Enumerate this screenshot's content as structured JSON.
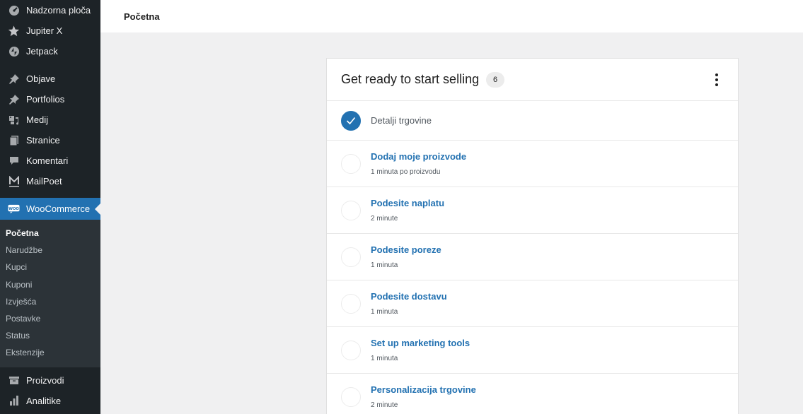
{
  "sidebar": {
    "items": [
      {
        "label": "Nadzorna ploča",
        "icon": "dashboard-icon"
      },
      {
        "label": "Jupiter X",
        "icon": "star-icon"
      },
      {
        "label": "Jetpack",
        "icon": "jetpack-icon"
      },
      {
        "label": "Objave",
        "icon": "pin-icon"
      },
      {
        "label": "Portfolios",
        "icon": "pin-icon"
      },
      {
        "label": "Medij",
        "icon": "media-icon"
      },
      {
        "label": "Stranice",
        "icon": "pages-icon"
      },
      {
        "label": "Komentari",
        "icon": "comment-icon"
      },
      {
        "label": "MailPoet",
        "icon": "mailpoet-icon"
      },
      {
        "label": "WooCommerce",
        "icon": "woocommerce-icon"
      },
      {
        "label": "Proizvodi",
        "icon": "products-icon"
      },
      {
        "label": "Analitike",
        "icon": "analytics-icon"
      }
    ],
    "submenu": [
      "Početna",
      "Narudžbe",
      "Kupci",
      "Kuponi",
      "Izvješća",
      "Postavke",
      "Status",
      "Ekstenzije"
    ],
    "woo_badge": "WOO"
  },
  "header": {
    "title": "Početna"
  },
  "card": {
    "title": "Get ready to start selling",
    "count": "6",
    "tasks": [
      {
        "title": "Detalji trgovine",
        "done": true
      },
      {
        "title": "Dodaj moje proizvode",
        "subtitle": "1 minuta po proizvodu"
      },
      {
        "title": "Podesite naplatu",
        "subtitle": "2 minute"
      },
      {
        "title": "Podesite poreze",
        "subtitle": "1 minuta"
      },
      {
        "title": "Podesite dostavu",
        "subtitle": "1 minuta"
      },
      {
        "title": "Set up marketing tools",
        "subtitle": "1 minuta"
      },
      {
        "title": "Personalizacija trgovine",
        "subtitle": "2 minute"
      }
    ]
  },
  "colors": {
    "accent": "#2271b1",
    "sidebar_bg": "#1d2327",
    "submenu_bg": "#2c3338",
    "page_bg": "#f0f0f1"
  }
}
